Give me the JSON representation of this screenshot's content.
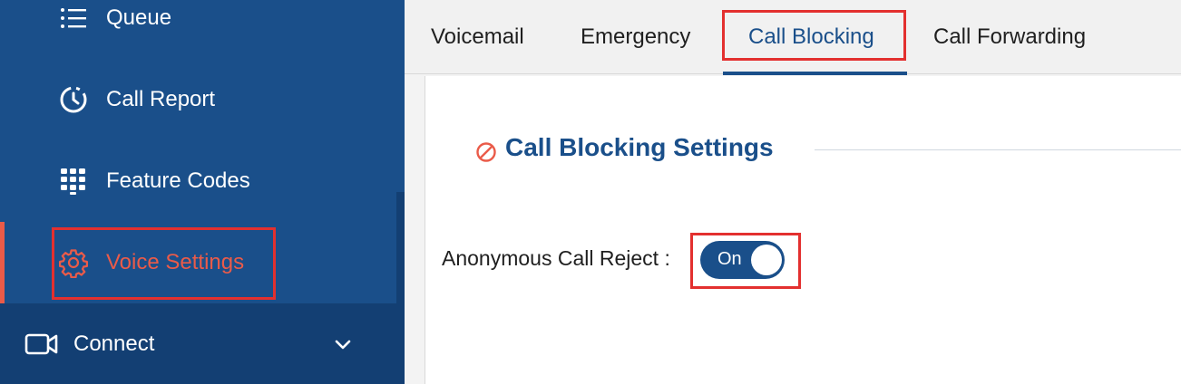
{
  "sidebar": {
    "items": [
      {
        "label": "Queue",
        "icon": "list-icon"
      },
      {
        "label": "Call Report",
        "icon": "history-clock-icon"
      },
      {
        "label": "Feature Codes",
        "icon": "keypad-icon"
      },
      {
        "label": "Voice Settings",
        "icon": "gear-icon",
        "active": true
      }
    ],
    "connect": {
      "label": "Connect",
      "icon": "video-camera-icon"
    }
  },
  "tabs": [
    {
      "label": "Voicemail"
    },
    {
      "label": "Emergency"
    },
    {
      "label": "Call Blocking",
      "active": true
    },
    {
      "label": "Call Forwarding"
    }
  ],
  "section": {
    "title": "Call Blocking Settings",
    "icon": "block-icon"
  },
  "form": {
    "anonymous_call_reject_label": "Anonymous Call Reject :",
    "anonymous_call_reject_state": "On"
  },
  "colors": {
    "primary": "#1a4f8a",
    "sidebar_dark": "#133f73",
    "accent": "#ea5b49",
    "highlight": "#e3302f"
  }
}
